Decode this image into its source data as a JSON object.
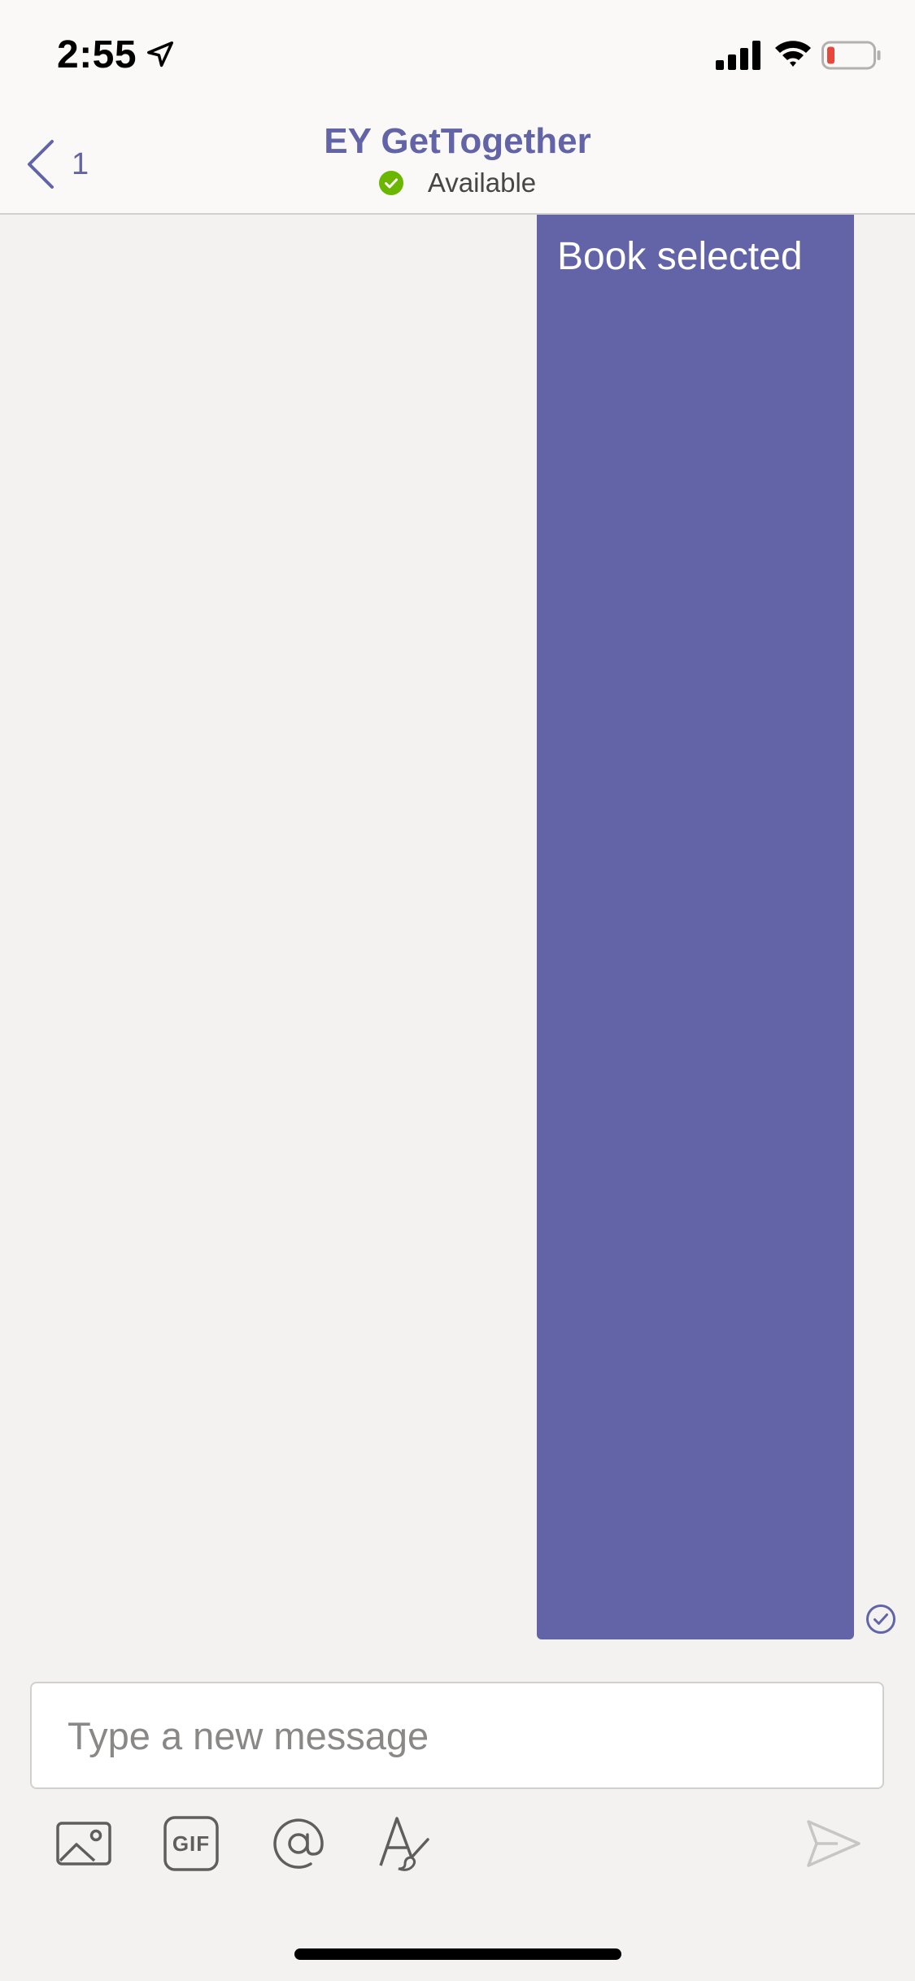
{
  "status_bar": {
    "time": "2:55"
  },
  "header": {
    "back_count": "1",
    "title": "EY GetTogether",
    "presence": "Available"
  },
  "messages": [
    {
      "text": "Book selected",
      "from_me": true,
      "status": "read"
    }
  ],
  "compose": {
    "placeholder": "Type a new message"
  },
  "toolbar": {
    "gif_label": "GIF"
  },
  "colors": {
    "brand": "#6264a7",
    "presence_available": "#6bb700",
    "battery_low": "#e8473c",
    "background": "#f3f2f1"
  },
  "icons": [
    "location-arrow-icon",
    "signal-icon",
    "wifi-icon",
    "battery-icon",
    "back-chevron-icon",
    "presence-check-icon",
    "read-receipt-icon",
    "image-icon",
    "gif-icon",
    "at-mention-icon",
    "format-icon",
    "send-icon"
  ]
}
